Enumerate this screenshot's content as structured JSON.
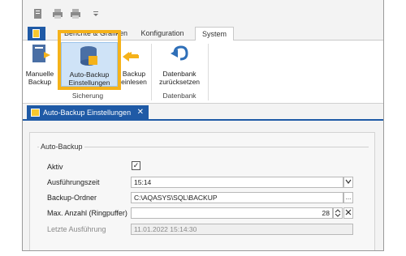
{
  "ribbon": {
    "tabs": [
      "Berichte & Grafiken",
      "Konfiguration",
      "System"
    ],
    "active_tab": "System",
    "buttons": {
      "manual_backup": "Manuelle\nBackup",
      "auto_backup": "Auto-Backup\nEinstellungen",
      "backup_read": "Backup\neinlesen",
      "db_reset": "Datenbank\nzurücksetzen"
    },
    "groups": [
      "Sicherung",
      "Datenbank"
    ]
  },
  "document_tab": {
    "title": "Auto-Backup Einstellungen",
    "close": "✕"
  },
  "form": {
    "legend": "Auto-Backup",
    "fields": {
      "aktiv_label": "Aktiv",
      "aktiv_value": "✓",
      "zeit_label": "Ausführungszeit",
      "zeit_value": "15:14",
      "ordner_label": "Backup-Ordner",
      "ordner_value": "C:\\AQASYS\\SQL\\BACKUP",
      "ordner_button": "...",
      "anzahl_label": "Max. Anzahl (Ringpuffer)",
      "anzahl_value": "28",
      "letzte_label": "Letzte Ausführung",
      "letzte_value": "11.01.2022 15:14:30"
    }
  },
  "colors": {
    "accent": "#1f5aa6",
    "highlight": "#f5b21a",
    "selected": "#cfe3f7"
  }
}
